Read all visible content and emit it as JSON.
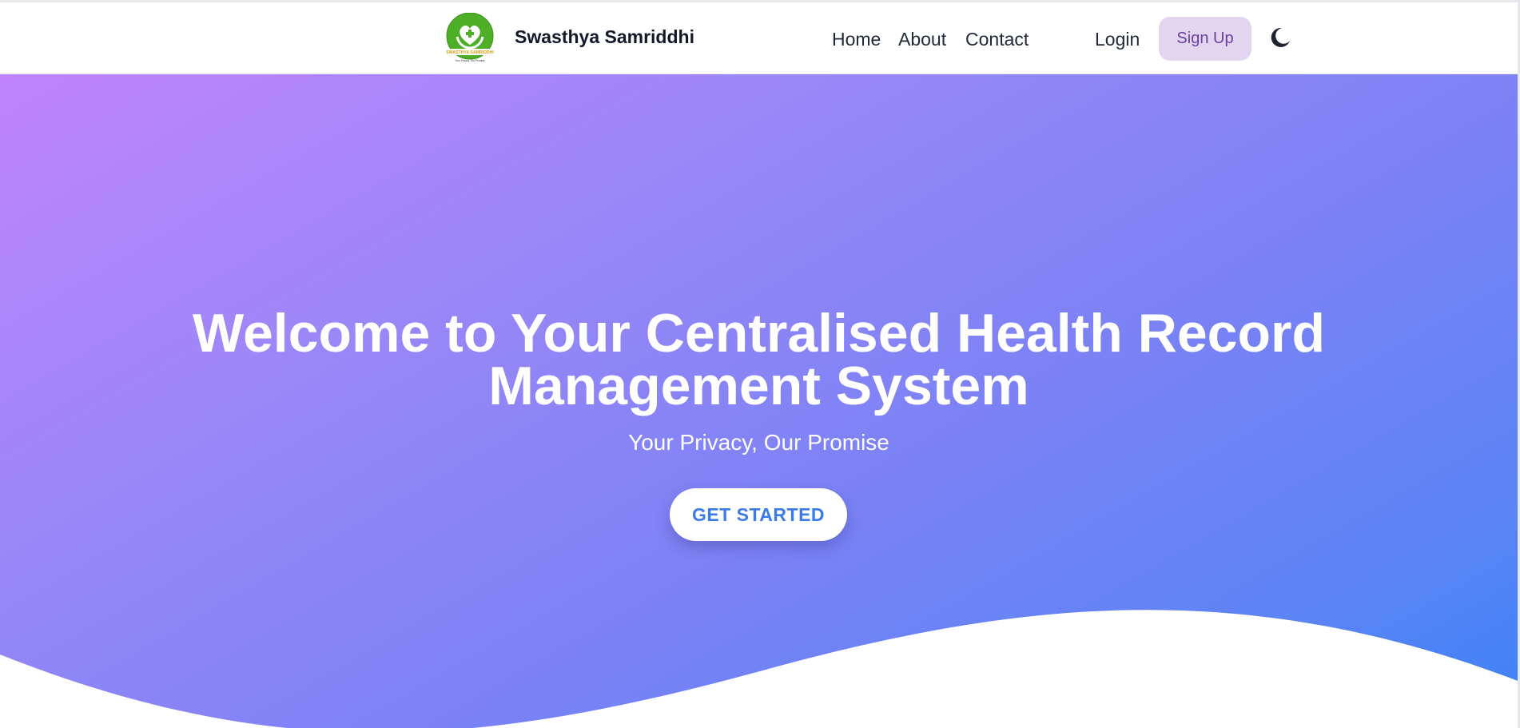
{
  "brand": {
    "name": "Swasthya Samriddhi",
    "logo_icon": "heart-hands-icon",
    "logo_text": "SWASTHYA SAMRIDDHI",
    "logo_tagline": "Your Privacy, Our Promise"
  },
  "nav": {
    "links": [
      "Home",
      "About",
      "Contact"
    ],
    "login_label": "Login",
    "signup_label": "Sign Up",
    "theme_toggle_icon": "moon-icon"
  },
  "hero": {
    "title_line1": "Welcome to Your Centralised Health Record",
    "title_line2": "Management System",
    "subtitle": "Your Privacy, Our Promise",
    "cta_label": "GET STARTED"
  },
  "colors": {
    "gradient_start": "#c084fc",
    "gradient_end": "#3b82f6",
    "signup_bg": "#e1d5ef",
    "signup_text": "#6b3fa0",
    "cta_text": "#3b7be8",
    "logo_green": "#4caf26"
  }
}
